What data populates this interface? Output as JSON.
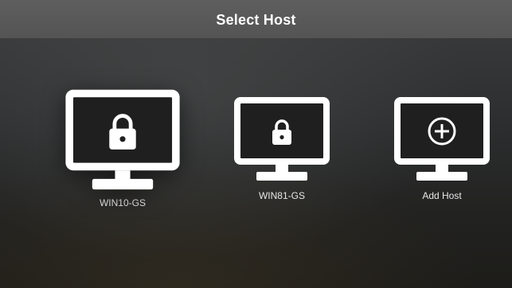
{
  "header": {
    "title": "Select Host"
  },
  "hosts": [
    {
      "label": "WIN10-GS",
      "icon": "lock-icon",
      "selected": true
    },
    {
      "label": "WIN81-GS",
      "icon": "lock-icon",
      "selected": false
    },
    {
      "label": "Add Host",
      "icon": "plus-circle-icon",
      "selected": false
    }
  ],
  "colors": {
    "header_bg": "#575757",
    "monitor_frame": "#ffffff",
    "monitor_screen": "#1e1e1e"
  }
}
